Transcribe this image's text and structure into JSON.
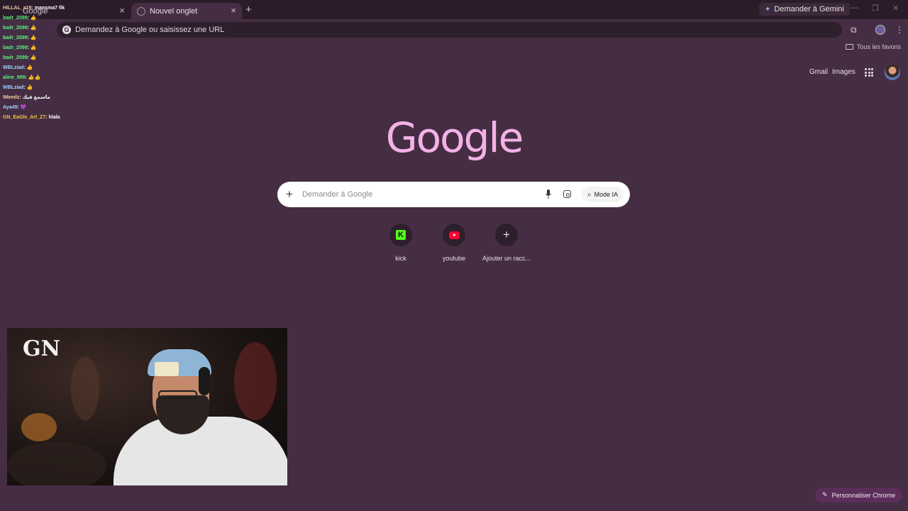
{
  "tabs": [
    {
      "label": "Google",
      "active": false
    },
    {
      "label": "Nouvel onglet",
      "active": true
    }
  ],
  "titlebar": {
    "gemini_label": "Demander à Gemini"
  },
  "omnibox": {
    "placeholder": "Demandez à Google ou saisissez une URL"
  },
  "bookmarks": {
    "all_label": "Tous les favoris"
  },
  "ntp": {
    "gmail": "Gmail",
    "images": "Images",
    "logo": "Google",
    "search_placeholder": "Demander à Google",
    "mode_ia": "Mode IA",
    "shortcuts": [
      {
        "label": "kick",
        "icon": "kick-icon",
        "color": "#53fc18"
      },
      {
        "label": "youtube",
        "icon": "youtube-icon",
        "color": "#ff0033"
      },
      {
        "label": "Ajouter un racc...",
        "icon": "plus-icon"
      }
    ],
    "customize": "Personnaliser Chrome"
  },
  "chat": [
    {
      "user": "HILLAL_a19",
      "msg": "mansma7 fik"
    },
    {
      "user": "badr_2099",
      "msg": "👍"
    },
    {
      "user": "badr_2099",
      "msg": "👍"
    },
    {
      "user": "badr_2099",
      "msg": "👍"
    },
    {
      "user": "badr_2099",
      "msg": "👍"
    },
    {
      "user": "badr_2099",
      "msg": "👍"
    },
    {
      "user": "WBLziad",
      "msg": "👍"
    },
    {
      "user": "aline_999",
      "msg": "👍👍"
    },
    {
      "user": "WBLziad",
      "msg": "👍"
    },
    {
      "user": "IMeedz",
      "msg": "ماسمع فيك"
    },
    {
      "user": "Aya49",
      "msg": "💜"
    },
    {
      "user": "GN_EaGle_Art_Z7",
      "msg": "hlala"
    }
  ],
  "webcam": {
    "logo_text": "GN"
  },
  "colors": {
    "background": "#452e43",
    "logo": "#f4b2e6",
    "accent": "#5b2e5a"
  }
}
